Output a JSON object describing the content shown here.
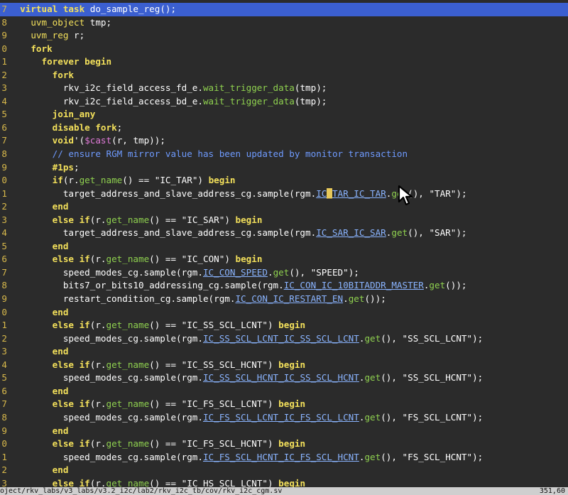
{
  "editor": {
    "lines": [
      {
        "n": "7",
        "current": true,
        "segs": [
          {
            "t": "  ",
            "c": "plain"
          },
          {
            "t": "virtual task",
            "c": "keyword"
          },
          {
            "t": " do_sample_reg();",
            "c": "plain"
          }
        ]
      },
      {
        "n": "8",
        "segs": [
          {
            "t": "    ",
            "c": "plain"
          },
          {
            "t": "uvm_object",
            "c": "type"
          },
          {
            "t": " tmp;",
            "c": "plain"
          }
        ]
      },
      {
        "n": "9",
        "segs": [
          {
            "t": "    ",
            "c": "plain"
          },
          {
            "t": "uvm_reg",
            "c": "type"
          },
          {
            "t": " r;",
            "c": "plain"
          }
        ]
      },
      {
        "n": "0",
        "segs": [
          {
            "t": "    ",
            "c": "plain"
          },
          {
            "t": "fork",
            "c": "keyword"
          }
        ]
      },
      {
        "n": "1",
        "segs": [
          {
            "t": "      ",
            "c": "plain"
          },
          {
            "t": "forever begin",
            "c": "keyword"
          }
        ]
      },
      {
        "n": "2",
        "segs": [
          {
            "t": "        ",
            "c": "plain"
          },
          {
            "t": "fork",
            "c": "keyword"
          }
        ]
      },
      {
        "n": "3",
        "segs": [
          {
            "t": "          rkv_i2c_field_access_fd_e.",
            "c": "plain"
          },
          {
            "t": "wait_trigger_data",
            "c": "method"
          },
          {
            "t": "(tmp);",
            "c": "plain"
          }
        ]
      },
      {
        "n": "4",
        "segs": [
          {
            "t": "          rkv_i2c_field_access_bd_e.",
            "c": "plain"
          },
          {
            "t": "wait_trigger_data",
            "c": "method"
          },
          {
            "t": "(tmp);",
            "c": "plain"
          }
        ]
      },
      {
        "n": "5",
        "segs": [
          {
            "t": "        ",
            "c": "plain"
          },
          {
            "t": "join_any",
            "c": "keyword"
          }
        ]
      },
      {
        "n": "6",
        "segs": [
          {
            "t": "        ",
            "c": "plain"
          },
          {
            "t": "disable fork",
            "c": "keyword"
          },
          {
            "t": ";",
            "c": "plain"
          }
        ]
      },
      {
        "n": "7",
        "segs": [
          {
            "t": "        ",
            "c": "plain"
          },
          {
            "t": "void",
            "c": "keyword"
          },
          {
            "t": "'(",
            "c": "plain"
          },
          {
            "t": "$cast",
            "c": "sys"
          },
          {
            "t": "(r, tmp));",
            "c": "plain"
          }
        ]
      },
      {
        "n": "8",
        "segs": [
          {
            "t": "        ",
            "c": "plain"
          },
          {
            "t": "// ensure RGM mirror value has been updated by monitor transaction",
            "c": "comment"
          }
        ]
      },
      {
        "n": "9",
        "segs": [
          {
            "t": "        ",
            "c": "plain"
          },
          {
            "t": "#1ps",
            "c": "keyword"
          },
          {
            "t": ";",
            "c": "plain"
          }
        ]
      },
      {
        "n": "0",
        "segs": [
          {
            "t": "        ",
            "c": "plain"
          },
          {
            "t": "if",
            "c": "keyword"
          },
          {
            "t": "(r.",
            "c": "plain"
          },
          {
            "t": "get_name",
            "c": "method"
          },
          {
            "t": "() == \"IC_TAR\") ",
            "c": "plain"
          },
          {
            "t": "begin",
            "c": "keyword"
          }
        ]
      },
      {
        "n": "1",
        "segs": [
          {
            "t": "          target_address_and_slave_address_cg.sample(rgm.",
            "c": "plain"
          },
          {
            "t": "IC",
            "c": "under"
          },
          {
            "t": "_",
            "c": "cursor"
          },
          {
            "t": "TAR_IC_TAR",
            "c": "under"
          },
          {
            "t": ".",
            "c": "plain"
          },
          {
            "t": "get",
            "c": "method"
          },
          {
            "t": "(), \"TAR\");",
            "c": "plain"
          }
        ]
      },
      {
        "n": "2",
        "segs": [
          {
            "t": "        ",
            "c": "plain"
          },
          {
            "t": "end",
            "c": "keyword"
          }
        ]
      },
      {
        "n": "3",
        "segs": [
          {
            "t": "        ",
            "c": "plain"
          },
          {
            "t": "else if",
            "c": "keyword"
          },
          {
            "t": "(r.",
            "c": "plain"
          },
          {
            "t": "get_name",
            "c": "method"
          },
          {
            "t": "() == \"IC_SAR\") ",
            "c": "plain"
          },
          {
            "t": "begin",
            "c": "keyword"
          }
        ]
      },
      {
        "n": "4",
        "segs": [
          {
            "t": "          target_address_and_slave_address_cg.sample(rgm.",
            "c": "plain"
          },
          {
            "t": "IC_SAR_IC_SAR",
            "c": "under"
          },
          {
            "t": ".",
            "c": "plain"
          },
          {
            "t": "get",
            "c": "method"
          },
          {
            "t": "(), \"SAR\");",
            "c": "plain"
          }
        ]
      },
      {
        "n": "5",
        "segs": [
          {
            "t": "        ",
            "c": "plain"
          },
          {
            "t": "end",
            "c": "keyword"
          }
        ]
      },
      {
        "n": "6",
        "segs": [
          {
            "t": "        ",
            "c": "plain"
          },
          {
            "t": "else if",
            "c": "keyword"
          },
          {
            "t": "(r.",
            "c": "plain"
          },
          {
            "t": "get_name",
            "c": "method"
          },
          {
            "t": "() == \"IC_CON\") ",
            "c": "plain"
          },
          {
            "t": "begin",
            "c": "keyword"
          }
        ]
      },
      {
        "n": "7",
        "segs": [
          {
            "t": "          speed_modes_cg.sample(rgm.",
            "c": "plain"
          },
          {
            "t": "IC_CON_SPEED",
            "c": "under"
          },
          {
            "t": ".",
            "c": "plain"
          },
          {
            "t": "get",
            "c": "method"
          },
          {
            "t": "(), \"SPEED\");",
            "c": "plain"
          }
        ]
      },
      {
        "n": "8",
        "segs": [
          {
            "t": "          bits7_or_bits10_addressing_cg.sample(rgm.",
            "c": "plain"
          },
          {
            "t": "IC_CON_IC_10BITADDR_MASTER",
            "c": "under"
          },
          {
            "t": ".",
            "c": "plain"
          },
          {
            "t": "get",
            "c": "method"
          },
          {
            "t": "());",
            "c": "plain"
          }
        ]
      },
      {
        "n": "9",
        "segs": [
          {
            "t": "          restart_condition_cg.sample(rgm.",
            "c": "plain"
          },
          {
            "t": "IC_CON_IC_RESTART_EN",
            "c": "under"
          },
          {
            "t": ".",
            "c": "plain"
          },
          {
            "t": "get",
            "c": "method"
          },
          {
            "t": "());",
            "c": "plain"
          }
        ]
      },
      {
        "n": "0",
        "segs": [
          {
            "t": "        ",
            "c": "plain"
          },
          {
            "t": "end",
            "c": "keyword"
          }
        ]
      },
      {
        "n": "1",
        "segs": [
          {
            "t": "        ",
            "c": "plain"
          },
          {
            "t": "else if",
            "c": "keyword"
          },
          {
            "t": "(r.",
            "c": "plain"
          },
          {
            "t": "get_name",
            "c": "method"
          },
          {
            "t": "() == \"IC_SS_SCL_LCNT\") ",
            "c": "plain"
          },
          {
            "t": "begin",
            "c": "keyword"
          }
        ]
      },
      {
        "n": "2",
        "segs": [
          {
            "t": "          speed_modes_cg.sample(rgm.",
            "c": "plain"
          },
          {
            "t": "IC_SS_SCL_LCNT_IC_SS_SCL_LCNT",
            "c": "under"
          },
          {
            "t": ".",
            "c": "plain"
          },
          {
            "t": "get",
            "c": "method"
          },
          {
            "t": "(), \"SS_SCL_LCNT\");",
            "c": "plain"
          }
        ]
      },
      {
        "n": "3",
        "segs": [
          {
            "t": "        ",
            "c": "plain"
          },
          {
            "t": "end",
            "c": "keyword"
          }
        ]
      },
      {
        "n": "4",
        "segs": [
          {
            "t": "        ",
            "c": "plain"
          },
          {
            "t": "else if",
            "c": "keyword"
          },
          {
            "t": "(r.",
            "c": "plain"
          },
          {
            "t": "get_name",
            "c": "method"
          },
          {
            "t": "() == \"IC_SS_SCL_HCNT\") ",
            "c": "plain"
          },
          {
            "t": "begin",
            "c": "keyword"
          }
        ]
      },
      {
        "n": "5",
        "segs": [
          {
            "t": "          speed_modes_cg.sample(rgm.",
            "c": "plain"
          },
          {
            "t": "IC_SS_SCL_HCNT_IC_SS_SCL_HCNT",
            "c": "under"
          },
          {
            "t": ".",
            "c": "plain"
          },
          {
            "t": "get",
            "c": "method"
          },
          {
            "t": "(), \"SS_SCL_HCNT\");",
            "c": "plain"
          }
        ]
      },
      {
        "n": "6",
        "segs": [
          {
            "t": "        ",
            "c": "plain"
          },
          {
            "t": "end",
            "c": "keyword"
          }
        ]
      },
      {
        "n": "7",
        "segs": [
          {
            "t": "        ",
            "c": "plain"
          },
          {
            "t": "else if",
            "c": "keyword"
          },
          {
            "t": "(r.",
            "c": "plain"
          },
          {
            "t": "get_name",
            "c": "method"
          },
          {
            "t": "() == \"IC_FS_SCL_LCNT\") ",
            "c": "plain"
          },
          {
            "t": "begin",
            "c": "keyword"
          }
        ]
      },
      {
        "n": "8",
        "segs": [
          {
            "t": "          speed_modes_cg.sample(rgm.",
            "c": "plain"
          },
          {
            "t": "IC_FS_SCL_LCNT_IC_FS_SCL_LCNT",
            "c": "under"
          },
          {
            "t": ".",
            "c": "plain"
          },
          {
            "t": "get",
            "c": "method"
          },
          {
            "t": "(), \"FS_SCL_LCNT\");",
            "c": "plain"
          }
        ]
      },
      {
        "n": "9",
        "segs": [
          {
            "t": "        ",
            "c": "plain"
          },
          {
            "t": "end",
            "c": "keyword"
          }
        ]
      },
      {
        "n": "0",
        "segs": [
          {
            "t": "        ",
            "c": "plain"
          },
          {
            "t": "else if",
            "c": "keyword"
          },
          {
            "t": "(r.",
            "c": "plain"
          },
          {
            "t": "get_name",
            "c": "method"
          },
          {
            "t": "() == \"IC_FS_SCL_HCNT\") ",
            "c": "plain"
          },
          {
            "t": "begin",
            "c": "keyword"
          }
        ]
      },
      {
        "n": "1",
        "segs": [
          {
            "t": "          speed_modes_cg.sample(rgm.",
            "c": "plain"
          },
          {
            "t": "IC_FS_SCL_HCNT_IC_FS_SCL_HCNT",
            "c": "under"
          },
          {
            "t": ".",
            "c": "plain"
          },
          {
            "t": "get",
            "c": "method"
          },
          {
            "t": "(), \"FS_SCL_HCNT\");",
            "c": "plain"
          }
        ]
      },
      {
        "n": "2",
        "segs": [
          {
            "t": "        ",
            "c": "plain"
          },
          {
            "t": "end",
            "c": "keyword"
          }
        ]
      },
      {
        "n": "3",
        "segs": [
          {
            "t": "        ",
            "c": "plain"
          },
          {
            "t": "else if",
            "c": "keyword"
          },
          {
            "t": "(r.",
            "c": "plain"
          },
          {
            "t": "get_name",
            "c": "method"
          },
          {
            "t": "() == \"IC_HS_SCL_LCNT\") ",
            "c": "plain"
          },
          {
            "t": "begin",
            "c": "keyword"
          }
        ]
      }
    ]
  },
  "statusbar": {
    "path": "oject/rkv_labs/v3_labs/v3.2_i2c/lab2/rkv_i2c_tb/cov/rkv_i2c_cgm.sv",
    "position": "351,60"
  }
}
